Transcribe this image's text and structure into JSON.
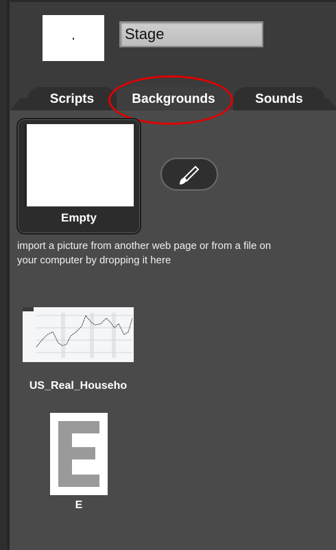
{
  "stage": {
    "name": "Stage"
  },
  "tabs": [
    {
      "label": "Scripts"
    },
    {
      "label": "Backgrounds"
    },
    {
      "label": "Sounds"
    }
  ],
  "current_costume": {
    "label": "Empty"
  },
  "import_hint": "import a picture from another web page or from a file on your computer by dropping it here",
  "backgrounds": [
    {
      "label": "US_Real_Househo",
      "thumb": "line-chart-thumbnail"
    },
    {
      "label": "E",
      "thumb": "letter-e-image"
    }
  ],
  "colors": {
    "panel": "#4a4a4a",
    "tab_dark": "#2f2f2f",
    "highlight_ring": "#e00000"
  },
  "icons": {
    "paint": "paintbrush-icon"
  }
}
